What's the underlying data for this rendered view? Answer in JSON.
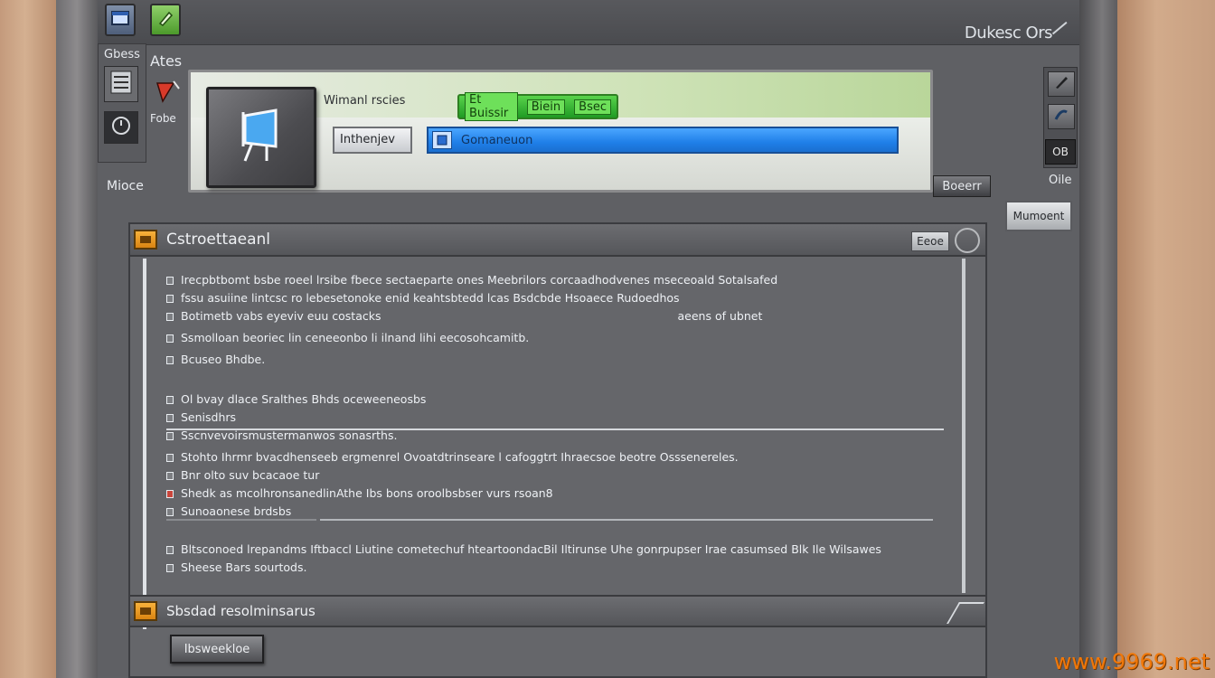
{
  "app": {
    "title": "Dukesc Ors"
  },
  "toolbar": {
    "blue_button": "window-icon",
    "green_button": "edit-icon"
  },
  "tool_column": {
    "label_top": "Gbess",
    "label_side": "Ates",
    "label_mid": "Fobe",
    "label_bottom": "Mioce"
  },
  "header": {
    "label": "Wimanl rscies",
    "green_chips": [
      "Et Buissir",
      "Biein",
      "Bsec"
    ],
    "combo_value": "Inthenjev",
    "search_value": "Gomaneuon"
  },
  "right_tools": {
    "ob_label": "OB",
    "side_label": "Oile",
    "tab_label": "Boeerr",
    "modal_label": "Mumoent"
  },
  "section1": {
    "title": "Cstroettaeanl",
    "chip": "Eeoe",
    "lines_a": [
      "Irecpbtbomt bsbe roeel lrsibe fbece sectaeparte ones Meebrilors corcaadhodvenes mseceoald Sotalsafed",
      "fssu asuiine lintcsc ro lebesetonoke enid keahtsbtedd lcas Bsdcbde Hsoaece Rudoedhos",
      "Botimetb vabs eyeviv euu costacks",
      "Ssmolloan beoriec lin ceneeonbo li ilnand lihi eecosohcamitb.",
      "Bcuseo Bhdbe."
    ],
    "lines_a_note": "aeens of ubnet",
    "lines_b": [
      "Ol bvay dlace Sralthes Bhds oceweeneosbs",
      "Senisdhrs",
      "Sscnvevoirsmustermanwos sonasrths."
    ],
    "lines_c": [
      "Stohto Ihrmr bvacdhenseeb ergmenrel Ovoatdtrinseare l cafoggtrt Ihraecsoe beotre Osssenereles.",
      "Bnr olto suv bcacaoe tur",
      "Shedk as mcolhronsanedlinAthe Ibs bons oroolbsbser vurs rsoan8",
      "Sunoaonese brdsbs"
    ],
    "lines_d": [
      "Bltsconoed lrepandms Iftbaccl Liutine cometechuf hteartoondacBil Iltirunse Uhe gonrpupser Irae casumsed Blk Ile Wilsawes",
      "Sheese Bars sourtods."
    ]
  },
  "section2": {
    "title": "Sbsdad resolminsarus",
    "button": "Ibsweekloe"
  },
  "watermark": "www.9969.net"
}
